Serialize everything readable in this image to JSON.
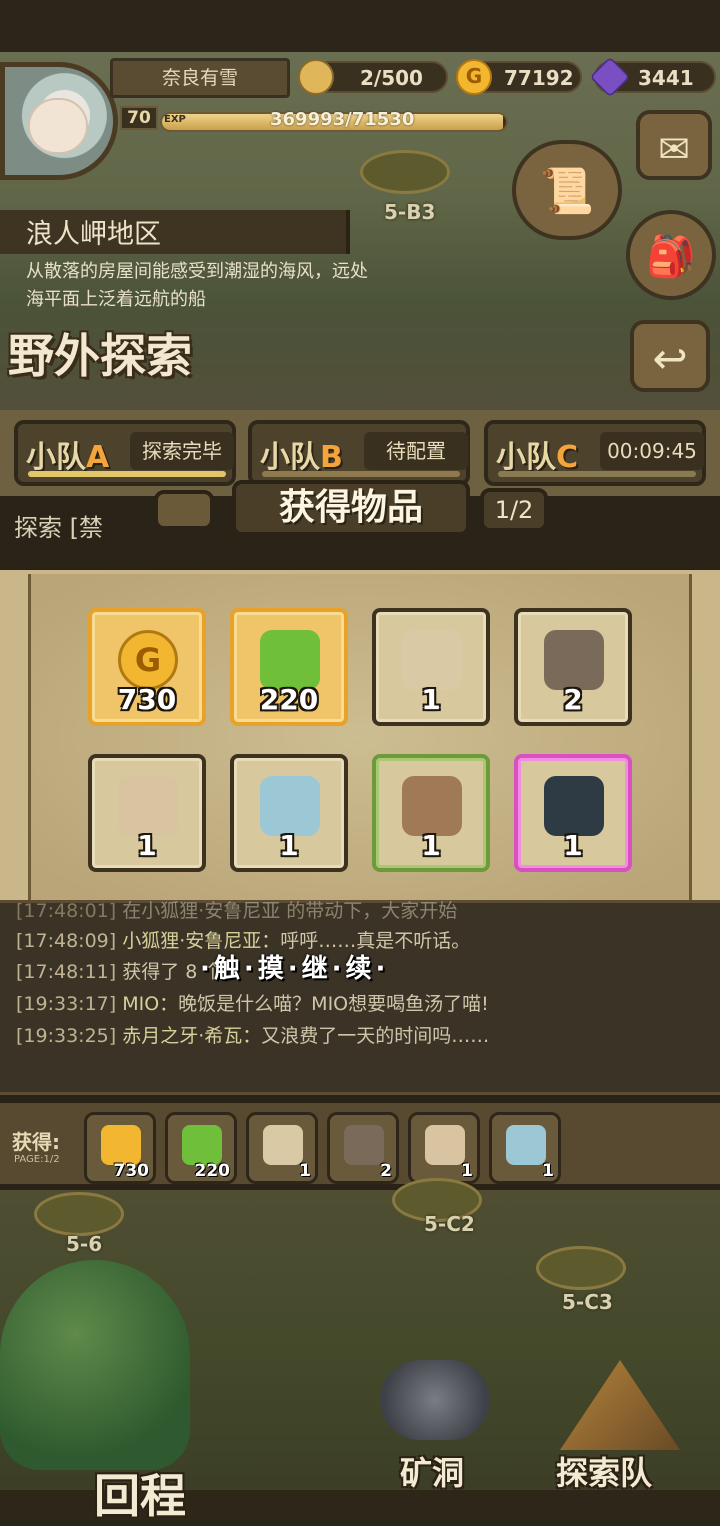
{
  "header": {
    "player_name": "奈良有雪",
    "level": "70",
    "exp_tag": "EXP",
    "exp_text": "369993/71530",
    "exp_progress": 0.99,
    "stamina": "2/500",
    "gold": "77192",
    "gems": "3441"
  },
  "stages": {
    "top": "5-B3",
    "bottom_left": "5-6",
    "bottom_mid": "5-C2",
    "bottom_right": "5-C3"
  },
  "area": {
    "name": "浪人岬地区",
    "description": "从散落的房屋间能感受到潮湿的海风，远处海平面上泛着远航的船",
    "section_title": "野外探索"
  },
  "squads": [
    {
      "name_prefix": "小队",
      "letter": "A",
      "status": "探索完毕"
    },
    {
      "name_prefix": "小队",
      "letter": "B",
      "status": "待配置"
    },
    {
      "name_prefix": "小队",
      "letter": "C",
      "status": "00:09:45"
    }
  ],
  "explore_line": "探索 [禁",
  "popup": {
    "title": "获得物品",
    "page": "1/2",
    "items": [
      {
        "name": "gold-coin",
        "count": "730",
        "rarity": "gold",
        "color": "#f2b630"
      },
      {
        "name": "green-feather",
        "count": "220",
        "rarity": "gold",
        "color": "#6fbf3a"
      },
      {
        "name": "flour-sack",
        "count": "1",
        "rarity": "normal",
        "color": "#d9c9a5"
      },
      {
        "name": "pickaxe",
        "count": "2",
        "rarity": "normal",
        "color": "#7a6a5a"
      },
      {
        "name": "stone-blocks",
        "count": "1",
        "rarity": "normal",
        "color": "#d8c4a0"
      },
      {
        "name": "water-bowl",
        "count": "1",
        "rarity": "normal",
        "color": "#9cc8d6"
      },
      {
        "name": "rope",
        "count": "1",
        "rarity": "green",
        "color": "#a07a56"
      },
      {
        "name": "dark-ore",
        "count": "1",
        "rarity": "purple",
        "color": "#2e3a44"
      }
    ]
  },
  "log": {
    "lines": [
      {
        "ts": "[17:48:01]",
        "text": "在小狐狸·安鲁尼亚 的带动下，大家开始"
      },
      {
        "ts": "[17:48:09]",
        "who": "小狐狸·安鲁尼亚：",
        "text": "呼呼……真是不听话。"
      },
      {
        "ts": "[17:48:11]",
        "text": "获得了 8 个"
      },
      {
        "ts": "[19:33:17]",
        "who": "MIO：",
        "text": "晚饭是什么喵？MIO想要喝鱼汤了喵!"
      },
      {
        "ts": "[19:33:25]",
        "who": "赤月之牙·希瓦：",
        "text": "又浪费了一天的时间吗……"
      }
    ],
    "tap_continue": "·触·摸·继·续·"
  },
  "acquired": {
    "label": "获得:",
    "page": "PAGE:1/2",
    "items": [
      {
        "count": "730",
        "color": "#f2b630"
      },
      {
        "count": "220",
        "color": "#6fbf3a"
      },
      {
        "count": "1",
        "color": "#d9c9a5"
      },
      {
        "count": "2",
        "color": "#7a6a5a"
      },
      {
        "count": "1",
        "color": "#d8c4a0"
      },
      {
        "count": "1",
        "color": "#9cc8d6"
      }
    ]
  },
  "bottom_nav": {
    "return": "回程",
    "mine": "矿洞",
    "team": "探索队"
  }
}
